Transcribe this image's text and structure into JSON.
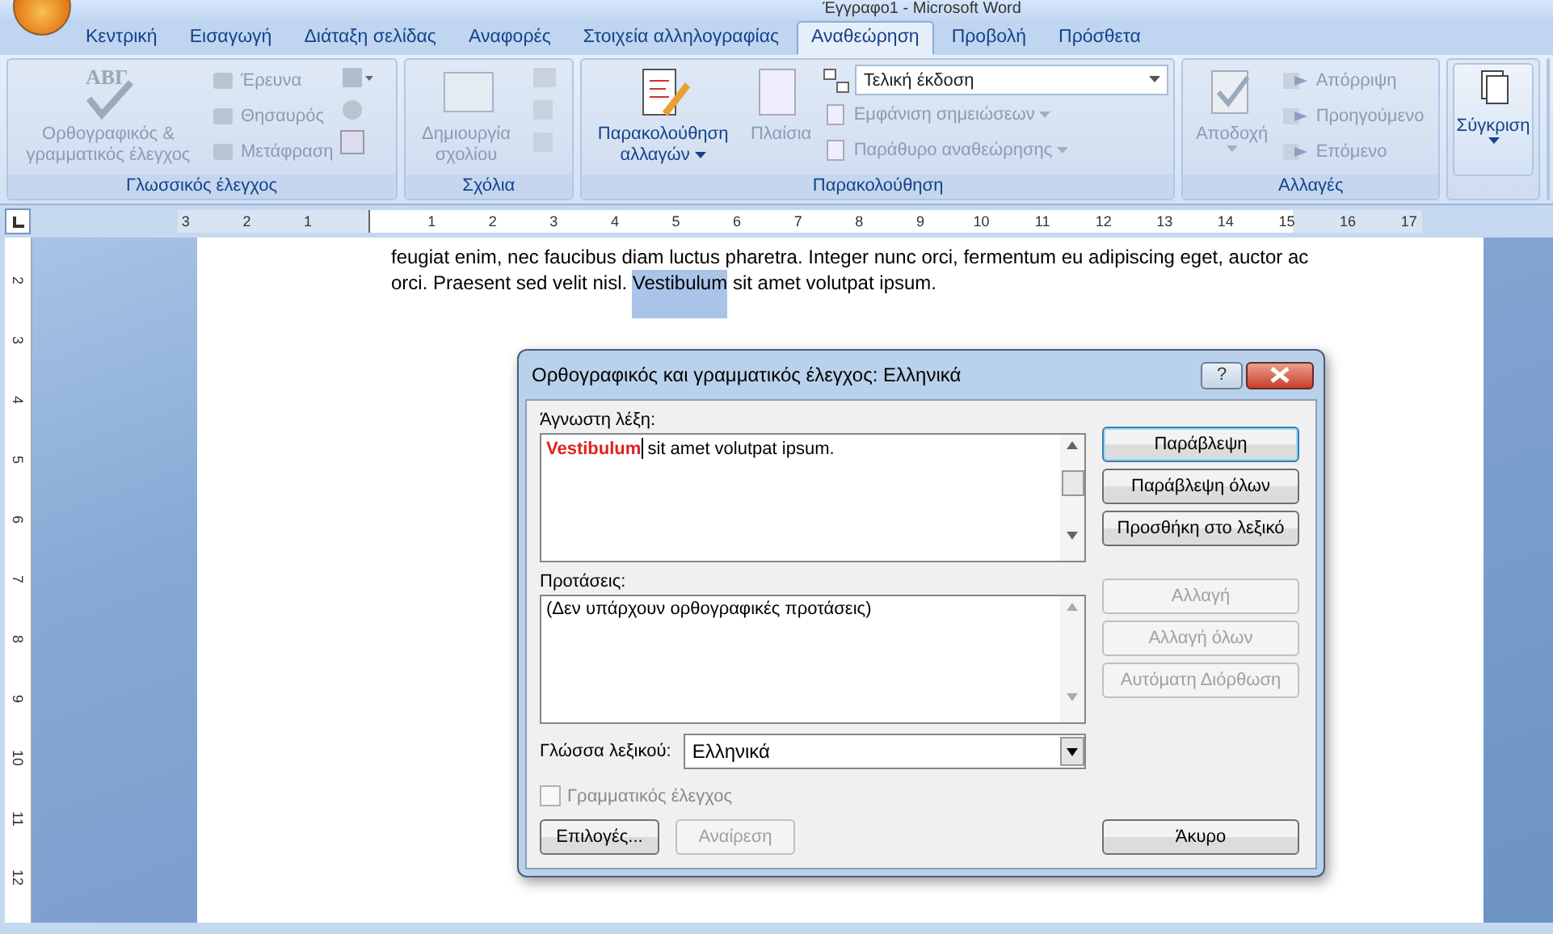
{
  "window": {
    "title": "Έγγραφο1 - Microsoft Word"
  },
  "tabs": [
    {
      "label": "Κεντρική",
      "selected": false
    },
    {
      "label": "Εισαγωγή",
      "selected": false
    },
    {
      "label": "Διάταξη σελίδας",
      "selected": false
    },
    {
      "label": "Αναφορές",
      "selected": false
    },
    {
      "label": "Στοιχεία αλληλογραφίας",
      "selected": false
    },
    {
      "label": "Αναθεώρηση",
      "selected": true
    },
    {
      "label": "Προβολή",
      "selected": false
    },
    {
      "label": "Πρόσθετα",
      "selected": false
    }
  ],
  "ribbon": {
    "proofing": {
      "label": "Γλωσσικός έλεγχος",
      "spelling": {
        "icon_text": "ΑΒΓ",
        "label": "Ορθογραφικός & γραμματικός έλεγχος",
        "disabled": true
      },
      "small": [
        {
          "label": "Έρευνα",
          "disabled": true
        },
        {
          "label": "Θησαυρός",
          "disabled": true
        },
        {
          "label": "Μετάφραση",
          "disabled": true
        }
      ]
    },
    "comments": {
      "label": "Σχόλια",
      "new_comment": {
        "label": "Δημιουργία σχολίου",
        "disabled": true
      }
    },
    "tracking": {
      "label": "Παρακολούθηση",
      "track_changes": {
        "label": "Παρακολούθηση αλλαγών",
        "disabled": false
      },
      "balloons": {
        "label": "Πλαίσια",
        "disabled": true
      },
      "display": {
        "value": "Τελική έκδοση"
      },
      "small": [
        {
          "label": "Εμφάνιση σημειώσεων",
          "disabled": true
        },
        {
          "label": "Παράθυρο αναθεώρησης",
          "disabled": true
        }
      ]
    },
    "changes": {
      "label": "Αλλαγές",
      "accept": {
        "label": "Αποδοχή",
        "disabled": true
      },
      "small": [
        {
          "label": "Απόρριψη",
          "disabled": true
        },
        {
          "label": "Προηγούμενο",
          "disabled": true
        },
        {
          "label": "Επόμενο",
          "disabled": true
        }
      ]
    },
    "compare": {
      "label": "Σύγκριση",
      "disabled": false
    }
  },
  "ruler": {
    "left_labels": [
      "3",
      "2",
      "1"
    ],
    "labels": [
      "1",
      "2",
      "3",
      "4",
      "5",
      "6",
      "7",
      "8",
      "9",
      "10",
      "11",
      "12",
      "13",
      "14",
      "15",
      "16",
      "17"
    ],
    "vertical_labels": [
      "2",
      "3",
      "4",
      "5",
      "6",
      "7",
      "8",
      "9",
      "10",
      "11",
      "12"
    ]
  },
  "document": {
    "line_1": "feugiat enim, nec faucibus diam luctus pharetra. Integer nunc orci, fermentum eu adipiscing eget, auctor ac",
    "line_2": {
      "before": "orci. Praesent sed velit nisl. ",
      "selected": "Vestibulum",
      "after": " sit amet volutpat ipsum."
    }
  },
  "dialog": {
    "title": "Ορθογραφικός και γραμματικός έλεγχος: Ελληνικά",
    "help": "?",
    "unknown_label": "Άγνωστη λέξη:",
    "unknown": {
      "word": "Vestibulum",
      "rest": " sit amet volutpat ipsum."
    },
    "suggestions_label": "Προτάσεις:",
    "suggestions": [
      "(Δεν υπάρχουν ορθογραφικές προτάσεις)"
    ],
    "language_label": "Γλώσσα λεξικού:",
    "language": "Ελληνικά",
    "grammar": {
      "label": "Γραμματικός έλεγχος",
      "checked": false,
      "disabled": true
    },
    "top_buttons": [
      {
        "label": "Παράβλεψη",
        "disabled": false,
        "default": true
      },
      {
        "label": "Παράβλεψη όλων",
        "disabled": false,
        "default": false
      },
      {
        "label": "Προσθήκη στο λεξικό",
        "disabled": false,
        "default": false
      }
    ],
    "change_buttons": [
      {
        "label": "Αλλαγή",
        "disabled": true
      },
      {
        "label": "Αλλαγή όλων",
        "disabled": true
      },
      {
        "label": "Αυτόματη Διόρθωση",
        "disabled": true
      }
    ],
    "bottom_buttons": [
      {
        "label": "Επιλογές...",
        "disabled": false
      },
      {
        "label": "Αναίρεση",
        "disabled": true
      }
    ],
    "cancel": {
      "label": "Άκυρο",
      "disabled": false
    }
  }
}
